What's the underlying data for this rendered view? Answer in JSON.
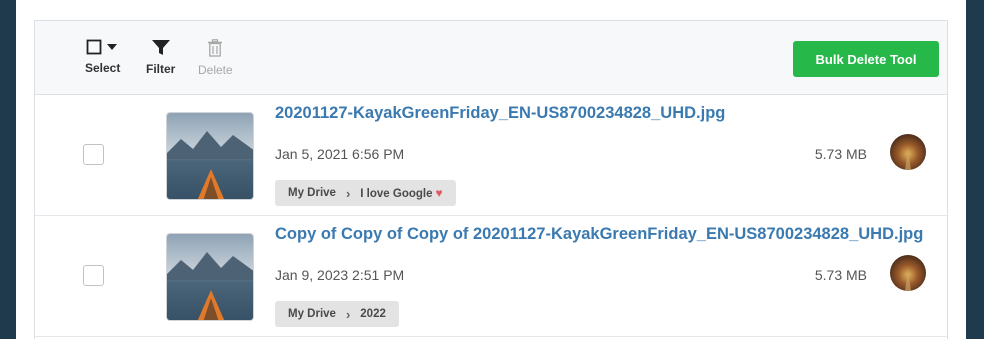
{
  "toolbar": {
    "select_label": "Select",
    "filter_label": "Filter",
    "delete_label": "Delete",
    "bulk_delete_label": "Bulk Delete Tool",
    "accent_color": "#27b84a"
  },
  "files": [
    {
      "name": "20201127-KayakGreenFriday_EN-US8700234828_UHD.jpg",
      "date": "Jan 5, 2021 6:56 PM",
      "size": "5.73 MB",
      "path": [
        "My Drive",
        "I love Google"
      ],
      "path_icon": "heart-icon"
    },
    {
      "name": "Copy of Copy of Copy of 20201127-KayakGreenFriday_EN-US8700234828_UHD.jpg",
      "date": "Jan 9, 2023 2:51 PM",
      "size": "5.73 MB",
      "path": [
        "My Drive",
        "2022"
      ]
    }
  ]
}
